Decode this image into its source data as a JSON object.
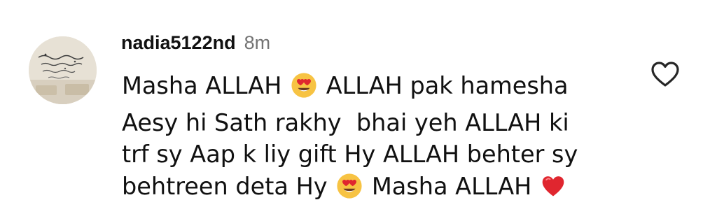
{
  "comment": {
    "username": "nadia5122nd",
    "timestamp": "8m",
    "lines": [
      {
        "before": "Masha ALLAH ",
        "emoji": "smiling-face-with-heart-eyes",
        "after": " ALLAH pak hamesha"
      },
      {
        "before": "Aesy hi Sath rakhy  bhai yeh ALLAH ki",
        "emoji": "",
        "after": ""
      },
      {
        "before": "trf sy Aap k liy gift Hy ALLAH behter sy",
        "emoji": "",
        "after": ""
      },
      {
        "before": "behtreen deta Hy ",
        "emoji": "smiling-face-with-heart-eyes",
        "after": " Masha ALLAH ",
        "emoji2": "red-heart"
      }
    ],
    "avatar_icon": "calligraphy-avatar-icon",
    "like_icon": "heart-outline-icon",
    "colors": {
      "username": "#111111",
      "timestamp": "#737373",
      "emoji_face": "#f7c343",
      "emoji_heart": "#e0262f",
      "like_outline": "#262626"
    }
  }
}
